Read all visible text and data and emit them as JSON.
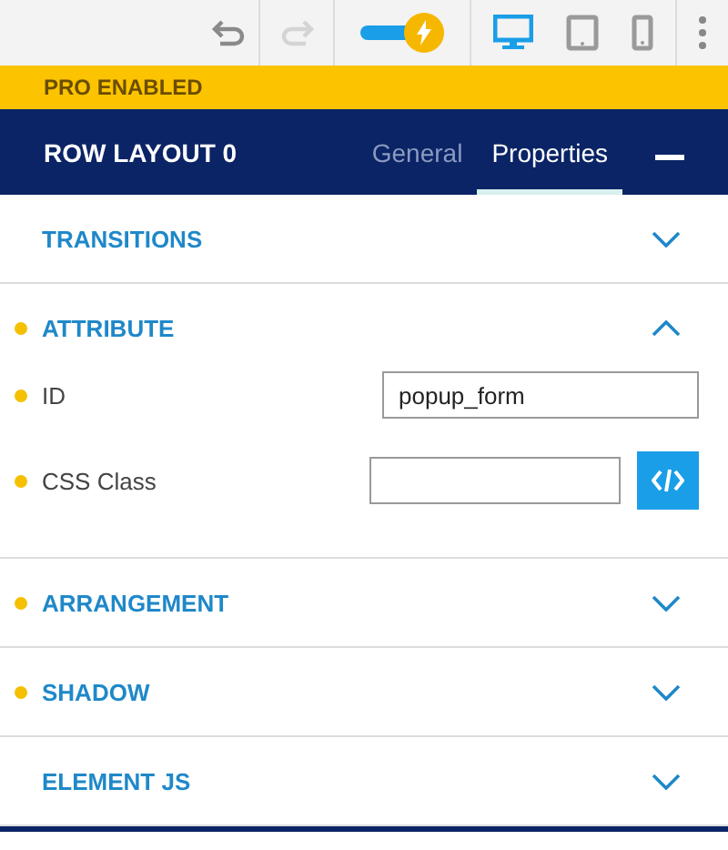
{
  "toolbar": {
    "undo_disabled": false,
    "redo_disabled": true,
    "pro_toggle": {
      "on": true
    },
    "devices": [
      {
        "kind": "desktop",
        "selected": true
      },
      {
        "kind": "tablet",
        "selected": false
      },
      {
        "kind": "phone",
        "selected": false
      }
    ]
  },
  "banner": {
    "text": "PRO ENABLED"
  },
  "header": {
    "title": "ROW LAYOUT 0",
    "tabs": [
      {
        "label": "General",
        "selected": false
      },
      {
        "label": "Properties",
        "selected": true
      }
    ]
  },
  "sections": [
    {
      "title": "TRANSITIONS",
      "modified": false,
      "expanded": false
    },
    {
      "title": "ATTRIBUTE",
      "modified": true,
      "expanded": true,
      "fields": [
        {
          "label": "ID",
          "modified": true,
          "value": "popup_form",
          "code_button": false
        },
        {
          "label": "CSS Class",
          "modified": true,
          "code_button": true
        }
      ]
    },
    {
      "title": "ARRANGEMENT",
      "modified": true,
      "expanded": false
    },
    {
      "title": "SHADOW",
      "modified": true,
      "expanded": false
    },
    {
      "title": "ELEMENT JS",
      "modified": false,
      "expanded": false
    }
  ]
}
